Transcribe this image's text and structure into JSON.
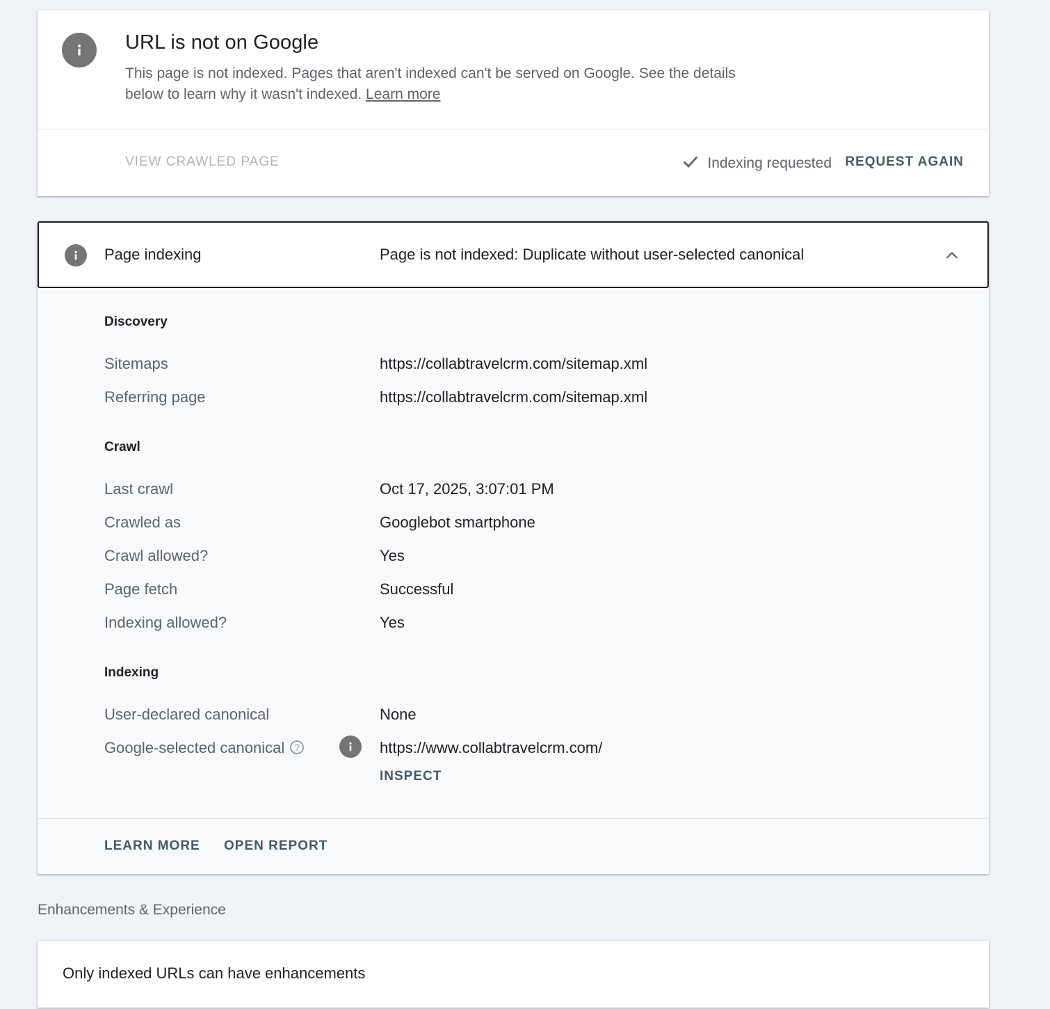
{
  "status": {
    "title": "URL is not on Google",
    "description": "This page is not indexed. Pages that aren't indexed can't be served on Google. See the details below to learn why it wasn't indexed.",
    "learn_more": "Learn more",
    "view_crawled_page": "VIEW CRAWLED PAGE",
    "indexing_requested": "Indexing requested",
    "request_again": "REQUEST AGAIN"
  },
  "page_indexing": {
    "label": "Page indexing",
    "status": "Page is not indexed: Duplicate without user-selected canonical",
    "discovery": {
      "heading": "Discovery",
      "rows": [
        {
          "label": "Sitemaps",
          "value": "https://collabtravelcrm.com/sitemap.xml"
        },
        {
          "label": "Referring page",
          "value": "https://collabtravelcrm.com/sitemap.xml"
        }
      ]
    },
    "crawl": {
      "heading": "Crawl",
      "rows": [
        {
          "label": "Last crawl",
          "value": "Oct 17, 2025, 3:07:01 PM"
        },
        {
          "label": "Crawled as",
          "value": "Googlebot smartphone"
        },
        {
          "label": "Crawl allowed?",
          "value": "Yes"
        },
        {
          "label": "Page fetch",
          "value": "Successful"
        },
        {
          "label": "Indexing allowed?",
          "value": "Yes"
        }
      ]
    },
    "indexing": {
      "heading": "Indexing",
      "rows": [
        {
          "label": "User-declared canonical",
          "value": "None"
        },
        {
          "label": "Google-selected canonical",
          "value": "https://www.collabtravelcrm.com/"
        }
      ],
      "help_glyph": "?",
      "inspect": "INSPECT"
    },
    "footer": {
      "learn_more": "LEARN MORE",
      "open_report": "OPEN REPORT"
    }
  },
  "enhancements": {
    "title": "Enhancements & Experience",
    "message": "Only indexed URLs can have enhancements"
  },
  "icons": {
    "info": "info-icon",
    "check": "check-icon",
    "chevron": "chevron-up-icon",
    "help": "help-icon"
  },
  "colors": {
    "background": "#f0f3f8",
    "link_button": "#455a64",
    "info_icon": "#757575",
    "disabled": "#b0b3b8"
  }
}
